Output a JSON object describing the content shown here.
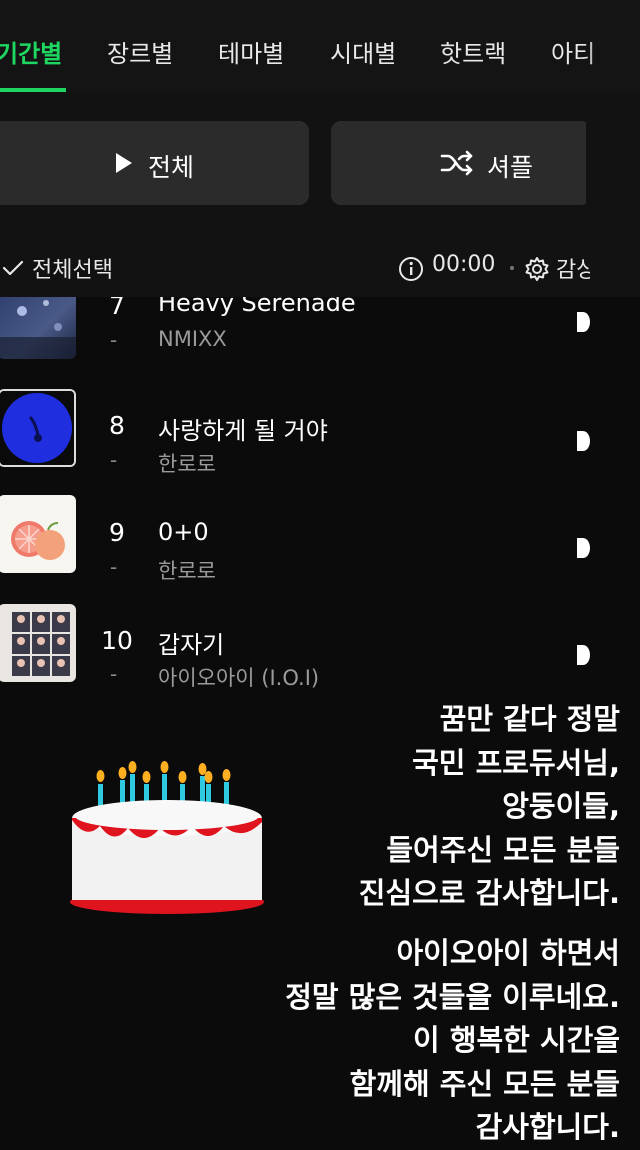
{
  "tabs": [
    {
      "label": "기간별",
      "active": true
    },
    {
      "label": "장르별",
      "active": false
    },
    {
      "label": "테마별",
      "active": false
    },
    {
      "label": "시대별",
      "active": false
    },
    {
      "label": "핫트랙",
      "active": false
    },
    {
      "label": "아티",
      "active": false
    }
  ],
  "controls": {
    "play_all": "전체",
    "shuffle": "셔플"
  },
  "select_row": {
    "select_all": "전체선택",
    "time": "00:00",
    "settings_label": "감상"
  },
  "tracks": [
    {
      "rank": "7",
      "change": "-",
      "title": "Heavy Serenade",
      "artist": "NMIXX",
      "cover_icon": "album-cover-sky"
    },
    {
      "rank": "8",
      "change": "-",
      "title": "사랑하게 될 거야",
      "artist": "한로로",
      "cover_icon": "album-cover-blue-circle"
    },
    {
      "rank": "9",
      "change": "-",
      "title": "0+0",
      "artist": "한로로",
      "cover_icon": "album-cover-grapefruit"
    },
    {
      "rank": "10",
      "change": "-",
      "title": "갑자기",
      "artist": "아이오아이 (I.O.I)",
      "cover_icon": "album-cover-group-grid"
    }
  ],
  "message": {
    "block1": [
      "꿈만 같다 정말",
      "국민 프로듀서님,",
      "앙둥이들,",
      "들어주신 모든 분들",
      "진심으로 감사합니다."
    ],
    "block2": [
      "아이오아이 하면서",
      "정말 많은 것들을 이루네요.",
      "이 행복한 시간을",
      "함께해 주신 모든 분들",
      "감사합니다."
    ]
  },
  "colors": {
    "accent": "#1ed760",
    "background": "#0b0b0b",
    "button": "#2b2b2b"
  }
}
